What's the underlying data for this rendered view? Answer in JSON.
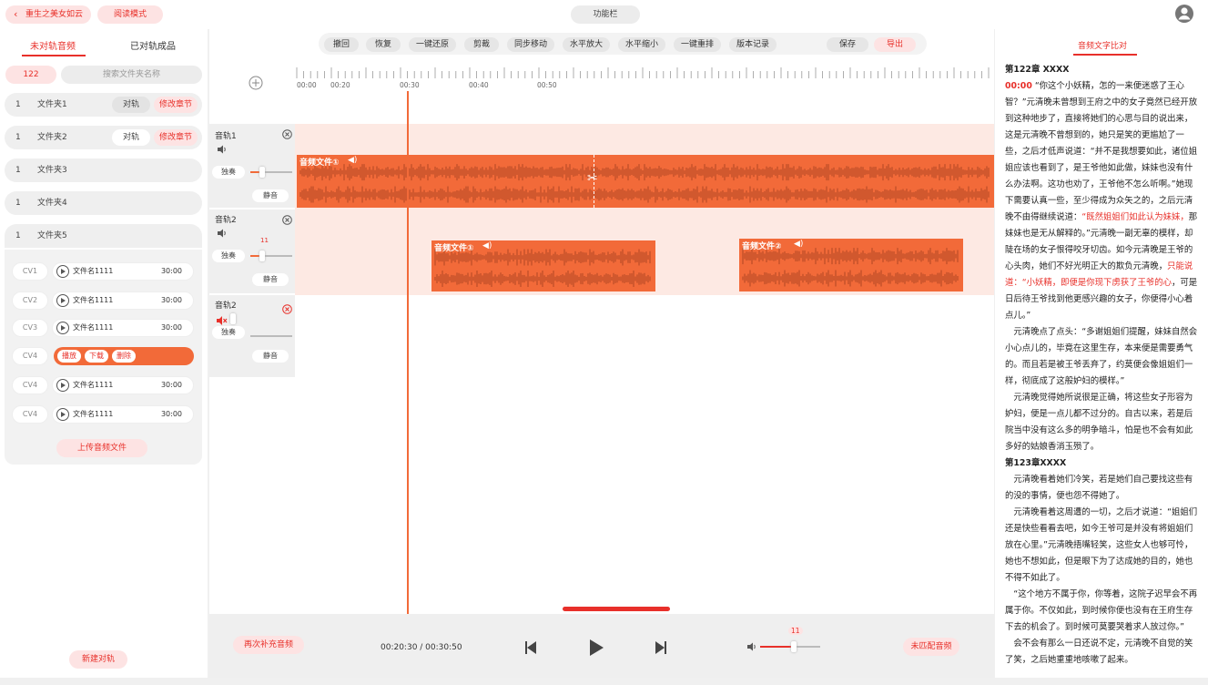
{
  "top": {
    "back_label": "重生之美女如云",
    "read_mode": "阅读模式",
    "toolbar_label": "功能栏"
  },
  "left": {
    "tabs": [
      "未对轨音频",
      "已对轨成品"
    ],
    "count": "122",
    "search_placeholder": "搜索文件夹名称",
    "folders": [
      {
        "n": "1",
        "name": "文件夹1",
        "align": "对轨",
        "edit": "修改章节"
      },
      {
        "n": "1",
        "name": "文件夹2",
        "align": "对轨",
        "edit": "修改章节"
      },
      {
        "n": "1",
        "name": "文件夹3"
      },
      {
        "n": "1",
        "name": "文件夹4"
      },
      {
        "n": "1",
        "name": "文件夹5"
      }
    ],
    "cv_rows": [
      {
        "cv": "CV1",
        "name": "文件名1111",
        "time": "30:00"
      },
      {
        "cv": "CV2",
        "name": "文件名1111",
        "time": "30:00"
      },
      {
        "cv": "CV3",
        "name": "文件名1111",
        "time": "30:00"
      },
      {
        "cv": "CV4",
        "actions": [
          "播放",
          "下载",
          "删除"
        ]
      },
      {
        "cv": "CV4",
        "name": "文件名1111",
        "time": "30:00"
      },
      {
        "cv": "CV4",
        "name": "文件名1111",
        "time": "30:00"
      }
    ],
    "upload": "上传音频文件",
    "new_track": "新建对轨"
  },
  "center": {
    "toolbar": [
      "撤回",
      "恢复",
      "一键还原",
      "剪裁",
      "同步移动",
      "水平放大",
      "水平缩小",
      "一键重排",
      "版本记录"
    ],
    "save": "保存",
    "export": "导出",
    "ruler": [
      "00:00",
      "00:20",
      "00:30",
      "00:40",
      "00:50"
    ],
    "tracks": [
      {
        "name": "音轨1",
        "solo": "独奏",
        "mute": "静音"
      },
      {
        "name": "音轨2",
        "solo": "独奏",
        "mute": "静音",
        "vol": "11"
      },
      {
        "name": "音轨2",
        "solo": "独奏",
        "mute": "静音"
      }
    ],
    "clips": [
      "音频文件①",
      "音频文件①",
      "音频文件②"
    ],
    "rematch": "再次补充音频",
    "time": "00:20:30 / 00:30:50",
    "volume": "11",
    "unmatched": "未匹配音频"
  },
  "right": {
    "tab": "音频文字比对",
    "ch1": "第122章 XXXX",
    "ts": "00:00",
    "p1a": " “你这个小妖精，怎的一来便迷惑了王心智？”元清晚未曾想到王府之中的女子竟然已经开放到这种地步了，直接将她们的心思与目的说出来，这是元清晚不曾想到的，她只是笑的更尴尬了一些，之后才低声说道：“并不是我想要如此，诸位姐姐应该也看到了，是王爷他如此做，妹妹也没有什么办法啊。这功也劝了，王爷他不怎么听啊。”她现下需要认真一些，至少得成为众矢之的，之后元清晚不由得继续说道：",
    "p1r": "“既然姐姐们如此认为妹妹，",
    "p1b": "那妹妹也是无从解释的。”元清晚一副无辜的模样，却陡在场的女子恨得咬牙切齿。如今元清晚是王爷的心头肉，她们不好光明正大的欺负元清晚，",
    "p1r2": "只能说道：“小妖精，即便是你现下虏获了王爷的心",
    "p1c": "，可是日后待王爷找到他更感兴趣的女子，你便得小心着点儿。”",
    "p2": "元清晚点了点头：“多谢姐姐们提醒，妹妹自然会小心点儿的，毕竟在这里生存，本来便是需要勇气的。而且若是被王爷丢弃了，约莫便会像姐姐们一样，彻底成了这般妒妇的模样。”",
    "p3": "元清晚觉得她所说很是正确，将这些女子形容为妒妇，便是一点儿都不过分的。自古以来，若是后院当中没有这么多的明争暗斗，怕是也不会有如此多好的姑娘香消玉殒了。",
    "ch2": "第123章XXXX",
    "p4": "元清晚看着她们冷笑，若是她们自己要找这些有的没的事情，便也怨不得她了。",
    "p5": "元清晚看着这周遭的一切，之后才说道：“姐姐们还是快些看看去吧，如今王爷可是并没有将姐姐们放在心里。”元清晚捂嘴轻笑，这些女人也够可怜，她也不想如此，但是眼下为了达成她的目的，她也不得不如此了。",
    "p6": "“这个地方不属于你，你等着，这院子迟早会不再属于你。不仅如此，到时候你便也没有在王府生存下去的机会了。到时候可莫要哭着求人放过你。”",
    "p7": "会不会有那么一日还说不定，元清晚不自觉的笑了笑，之后她重重地咳嗽了起来。"
  }
}
